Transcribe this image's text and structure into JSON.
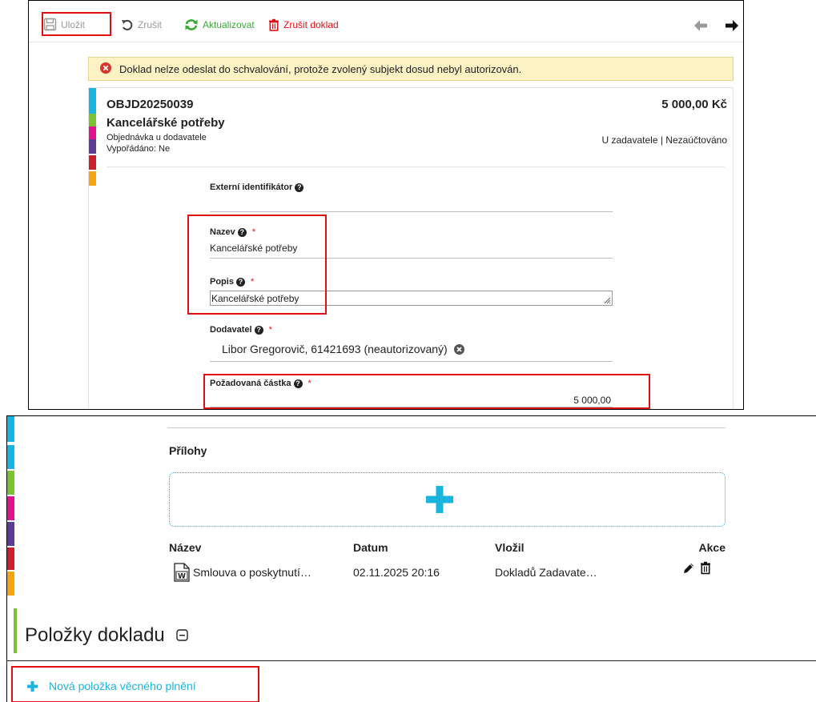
{
  "toolbar": {
    "save_label": "Uložit",
    "cancel_label": "Zrušit",
    "refresh_label": "Aktualizovat",
    "cancel_doc_label": "Zrušit doklad"
  },
  "alert": {
    "text": "Doklad nelze odeslat do schvalování, protože zvolený subjekt dosud nebyl autorizován."
  },
  "document": {
    "number": "OBJD20250039",
    "amount": "5 000,00 Kč",
    "title": "Kancelářské potřeby",
    "type": "Objednávka u dodavatele",
    "status": "U zadavatele | Nezaúčtováno",
    "settled": "Vypořádáno: Ne"
  },
  "form": {
    "external_id_label": "Externí identifikátor",
    "name_label": "Nazev",
    "name_value": "Kancelářské potřeby",
    "desc_label": "Popis",
    "desc_value": "Kancelářské potřeby",
    "supplier_label": "Dodavatel",
    "supplier_value": "Libor Gregorovič, 61421693 (neautorizovaný)",
    "amount_label": "Požadovaná částka",
    "amount_value": "5 000,00",
    "required_mark": "*"
  },
  "attachments": {
    "title": "Přílohy",
    "columns": [
      "Název",
      "Datum",
      "Vložil",
      "Akce"
    ],
    "rows": [
      {
        "name": "Smlouva o poskytnutí…",
        "date": "02.11.2025 20:16",
        "author": "Dokladů Zadavate…"
      }
    ]
  },
  "items_section": {
    "title": "Položky dokladu",
    "new_item_label": "Nová položka věcného plnění"
  },
  "colors": {
    "strip": [
      "#19b5de",
      "#19b5de",
      "#7ac231",
      "#e2128f",
      "#5e3c96",
      "#cc1f2c",
      "#f3a614"
    ],
    "accent": "#19b5de",
    "green": "#3aaa35",
    "red": "#e01010"
  }
}
